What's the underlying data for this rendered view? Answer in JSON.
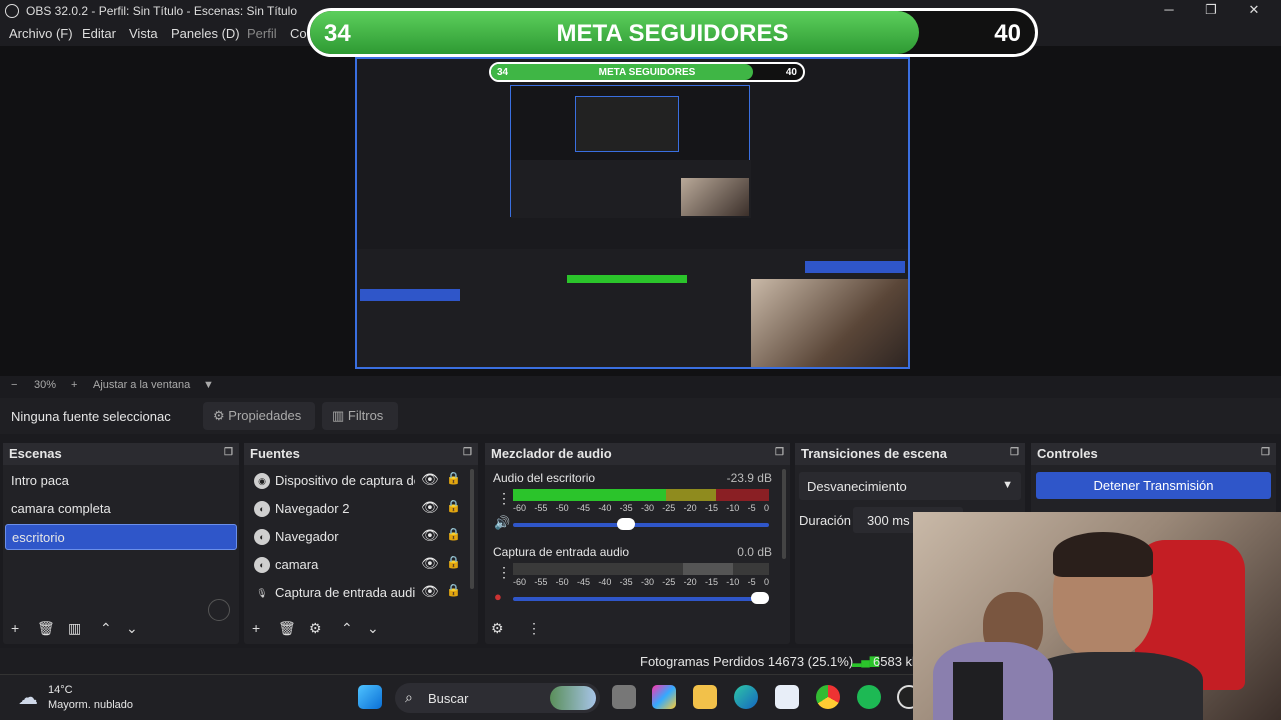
{
  "window": {
    "title": "OBS 32.0.2 - Perfil: Sin Título - Escenas: Sin Título"
  },
  "menu": [
    "Archivo (F)",
    "Editar",
    "Vista",
    "Paneles (D)",
    "Perfil",
    "Co"
  ],
  "overlay": {
    "left_value": "34",
    "label": "META SEGUIDORES",
    "right_value": "40",
    "progress": 0.85
  },
  "preview_overlay": {
    "left_value": "34",
    "label": "META SEGUIDORES",
    "right_value": "40"
  },
  "zoom": {
    "minus": "−",
    "level": "30%",
    "plus": "+",
    "fit": "Ajustar a la ventana"
  },
  "source_toolbar": {
    "no_source": "Ninguna fuente seleccionac",
    "properties": "Propiedades",
    "filters": "Filtros"
  },
  "scenes": {
    "title": "Escenas",
    "items": [
      "Intro paca",
      "camara completa",
      "escritorio"
    ],
    "selected": "escritorio"
  },
  "sources": {
    "title": "Fuentes",
    "items": [
      "Dispositivo de captura de",
      "Navegador 2",
      "Navegador",
      "camara",
      "Captura de entrada audio"
    ]
  },
  "mixer": {
    "title": "Mezclador de audio",
    "channels": [
      {
        "name": "Audio del escritorio",
        "db": "-23.9 dB",
        "volume": 0.43
      },
      {
        "name": "Captura de entrada audio",
        "db": "0.0 dB",
        "volume": 0.96
      }
    ],
    "ticks": [
      "-60",
      "-55",
      "-50",
      "-45",
      "-40",
      "-35",
      "-30",
      "-25",
      "-20",
      "-15",
      "-10",
      "-5",
      "0"
    ]
  },
  "transitions": {
    "title": "Transiciones de escena",
    "selected": "Desvanecimiento",
    "duration_label": "Duración",
    "duration_value": "300 ms"
  },
  "controls": {
    "title": "Controles",
    "stop_stream": "Detener Transmisión"
  },
  "status": {
    "dropped": "Fotogramas Perdidos 14673 (25.1%)",
    "bitrate": "6583 kb"
  },
  "taskbar": {
    "temp": "14°C",
    "weather": "Mayorm. nublado",
    "search": "Buscar"
  },
  "colors": {
    "accent": "#2f56c9",
    "goal_green": "#3fb645",
    "meter_green": "#2bc42b",
    "meter_yellow": "#8f8b1e",
    "meter_red": "#8a1f24"
  }
}
